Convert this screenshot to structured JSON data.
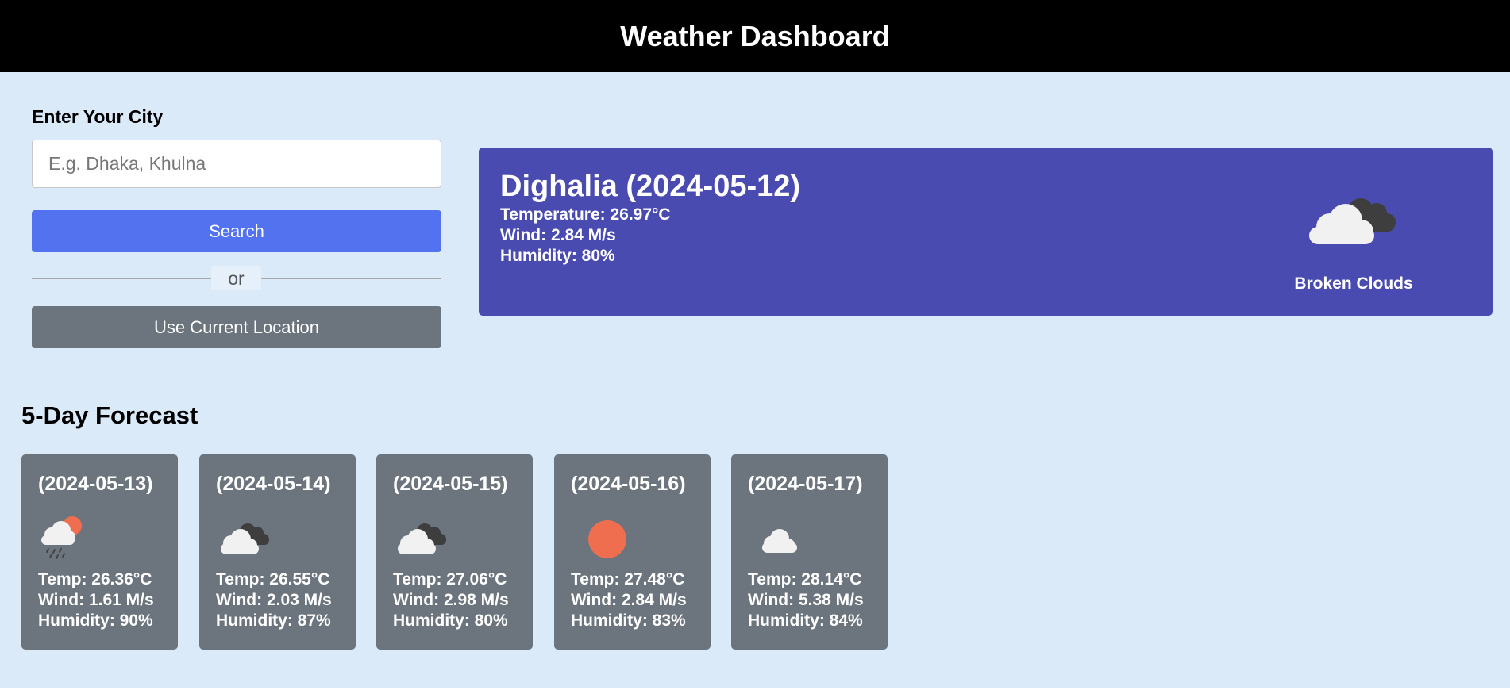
{
  "header": {
    "title": "Weather Dashboard"
  },
  "search": {
    "label": "Enter Your City",
    "placeholder": "E.g. Dhaka, Khulna",
    "value": "",
    "search_button": "Search",
    "or_text": "or",
    "location_button": "Use Current Location"
  },
  "current": {
    "title": "Dighalia (2024-05-12)",
    "temperature": "Temperature: 26.97°C",
    "wind": "Wind: 2.84 M/s",
    "humidity": "Humidity: 80%",
    "description": "Broken Clouds",
    "icon": "broken-clouds-icon"
  },
  "forecast": {
    "title": "5-Day Forecast",
    "days": [
      {
        "date": "(2024-05-13)",
        "icon": "rain-sun-icon",
        "temp": "Temp: 26.36°C",
        "wind": "Wind: 1.61 M/s",
        "humidity": "Humidity: 90%"
      },
      {
        "date": "(2024-05-14)",
        "icon": "broken-clouds-icon",
        "temp": "Temp: 26.55°C",
        "wind": "Wind: 2.03 M/s",
        "humidity": "Humidity: 87%"
      },
      {
        "date": "(2024-05-15)",
        "icon": "broken-clouds-icon",
        "temp": "Temp: 27.06°C",
        "wind": "Wind: 2.98 M/s",
        "humidity": "Humidity: 80%"
      },
      {
        "date": "(2024-05-16)",
        "icon": "clear-sun-icon",
        "temp": "Temp: 27.48°C",
        "wind": "Wind: 2.84 M/s",
        "humidity": "Humidity: 83%"
      },
      {
        "date": "(2024-05-17)",
        "icon": "few-clouds-icon",
        "temp": "Temp: 28.14°C",
        "wind": "Wind: 5.38 M/s",
        "humidity": "Humidity: 84%"
      }
    ]
  },
  "colors": {
    "header_bg": "#000000",
    "page_bg": "#dbeaf9",
    "search_button": "#5372f0",
    "secondary_button": "#6c757d",
    "current_card": "#4a4bb0",
    "forecast_card": "#6c757d",
    "sun": "#ee6e4f"
  }
}
